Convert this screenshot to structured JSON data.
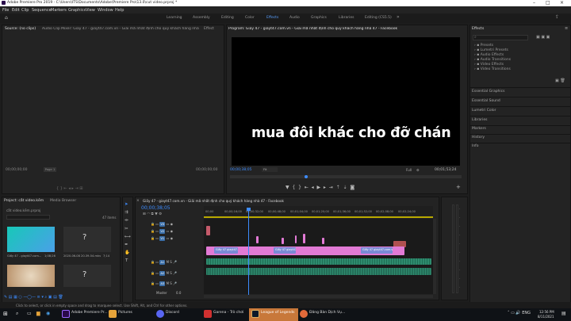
{
  "titlebar": {
    "title": "Adobe Premiere Pro 2019 - C:\\Users\\ITS\\Documents\\Adobe\\Premiere Pro\\13.0\\cut video.prproj *"
  },
  "menubar": {
    "items": [
      "File",
      "Edit",
      "Clip",
      "Sequence",
      "Markers",
      "Graphics",
      "View",
      "Window",
      "Help"
    ]
  },
  "workspaces": {
    "items": [
      "Learning",
      "Assembly",
      "Editing",
      "Color",
      "Effects",
      "Audio",
      "Graphics",
      "Libraries",
      "Editing (CS5.5)"
    ],
    "active": "Effects"
  },
  "source": {
    "tabs": [
      "Source: (no clips)",
      "Audio Clip Mixer: Giầy 47 - giayt47.com.vn - Giải mã nhất định cho quý khách hàng nhà 47 - Facebook",
      "Effect"
    ],
    "tc_left": "00;00;00;00",
    "tc_right": "00;00;00;00",
    "page": "Page 1"
  },
  "program": {
    "title": "Program: Giầy 47 - giayt47.com.vn - Giải mã nhất định cho quý khách hàng nhà 47 - Facebook",
    "caption": "mua đôi khác cho đỡ chán",
    "tc_current": "00;00;38;05",
    "tc_duration": "00;01;53;24",
    "fit": "Fit",
    "quality": "Full"
  },
  "effects": {
    "title": "Effects",
    "items": [
      "Presets",
      "Lumetri Presets",
      "Audio Effects",
      "Audio Transitions",
      "Video Effects",
      "Video Transitions"
    ],
    "sections": [
      "Essential Graphics",
      "Essential Sound",
      "Lumetri Color",
      "Libraries",
      "Markers",
      "History",
      "Info"
    ]
  },
  "project": {
    "tab": "Project: cắt video.kềm",
    "tab2": "Media Browser",
    "file": "cắt video.kềm.prproj",
    "count": "47 items",
    "items": [
      {
        "name": "Giầy 47 - giayt47.com...",
        "dur": "1;08;26"
      },
      {
        "name": "2020-06-08 20-39-54.mkv",
        "dur": "7;14"
      }
    ]
  },
  "timeline": {
    "tab": "Giầy 47 - giayt47.com.vn - Giải mã nhất định cho quý khách hàng nhà 47 - Facebook",
    "tc": "00;00;38;05",
    "ruler": [
      "00;00",
      "00;00;16;00",
      "00;00;32;00",
      "00;00;48;00",
      "00;01;04;00",
      "00;01;20;00",
      "00;01;36;00",
      "00;01;52;00",
      "00;02;08;00",
      "00;02;24;00"
    ],
    "video_tracks": [
      "V3",
      "V2",
      "V1"
    ],
    "audio_tracks": [
      "A1",
      "A2",
      "A3"
    ],
    "master": "Master",
    "master_val": "0.0",
    "clip_labels": [
      "Giầy 47 giayt47.com.vn",
      "Giầy 47 giayt47.com",
      "Giầy 47 giayt47.com.vn"
    ]
  },
  "statusbar": {
    "text": "Click to select, or click in empty space and drag to marquee select. Use Shift, Alt, and Ctrl for other options."
  },
  "taskbar": {
    "items": [
      "Adobe Premiere Pr...",
      "Pictures",
      "Discord",
      "Garena - Trò chơi",
      "League of Legends",
      "Đăng Bàn Dịch Vụ..."
    ],
    "time": "12:56 PM",
    "date": "8/11/2021"
  },
  "colors": {
    "accent": "#3d8cff",
    "clip_pink": "#e27ad5",
    "clip_blue": "#7a8ad6",
    "audio_green": "#2e8b6e"
  }
}
